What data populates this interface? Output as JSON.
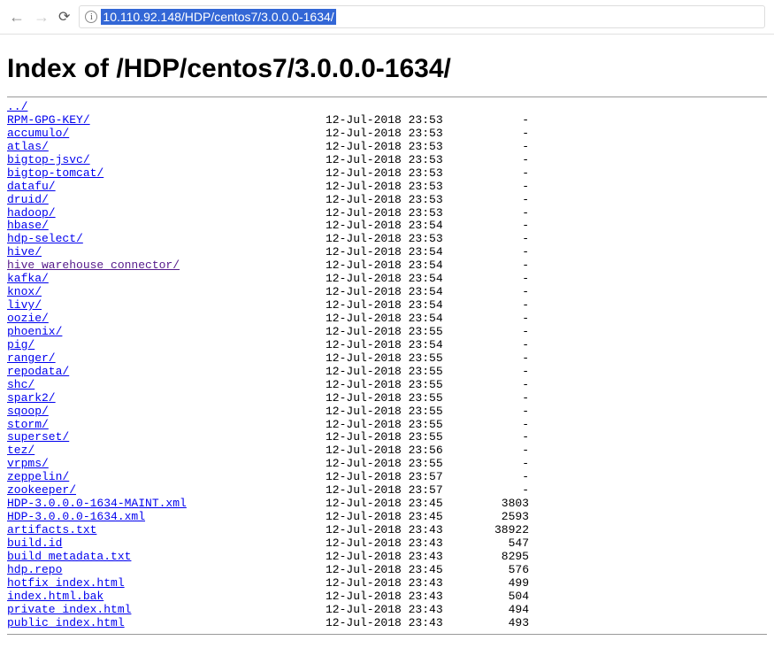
{
  "browser": {
    "url": "10.110.92.148/HDP/centos7/3.0.0.0-1634/"
  },
  "page": {
    "title": "Index of /HDP/centos7/3.0.0.0-1634/",
    "parent_link": "../",
    "entries": [
      {
        "name": "RPM-GPG-KEY/",
        "date": "12-Jul-2018 23:53",
        "size": "-",
        "visited": false
      },
      {
        "name": "accumulo/",
        "date": "12-Jul-2018 23:53",
        "size": "-",
        "visited": false
      },
      {
        "name": "atlas/",
        "date": "12-Jul-2018 23:53",
        "size": "-",
        "visited": false
      },
      {
        "name": "bigtop-jsvc/",
        "date": "12-Jul-2018 23:53",
        "size": "-",
        "visited": false
      },
      {
        "name": "bigtop-tomcat/",
        "date": "12-Jul-2018 23:53",
        "size": "-",
        "visited": false
      },
      {
        "name": "datafu/",
        "date": "12-Jul-2018 23:53",
        "size": "-",
        "visited": false
      },
      {
        "name": "druid/",
        "date": "12-Jul-2018 23:53",
        "size": "-",
        "visited": false
      },
      {
        "name": "hadoop/",
        "date": "12-Jul-2018 23:53",
        "size": "-",
        "visited": false
      },
      {
        "name": "hbase/",
        "date": "12-Jul-2018 23:54",
        "size": "-",
        "visited": false
      },
      {
        "name": "hdp-select/",
        "date": "12-Jul-2018 23:53",
        "size": "-",
        "visited": false
      },
      {
        "name": "hive/",
        "date": "12-Jul-2018 23:54",
        "size": "-",
        "visited": false
      },
      {
        "name": "hive_warehouse_connector/",
        "date": "12-Jul-2018 23:54",
        "size": "-",
        "visited": true
      },
      {
        "name": "kafka/",
        "date": "12-Jul-2018 23:54",
        "size": "-",
        "visited": false
      },
      {
        "name": "knox/",
        "date": "12-Jul-2018 23:54",
        "size": "-",
        "visited": false
      },
      {
        "name": "livy/",
        "date": "12-Jul-2018 23:54",
        "size": "-",
        "visited": false
      },
      {
        "name": "oozie/",
        "date": "12-Jul-2018 23:54",
        "size": "-",
        "visited": false
      },
      {
        "name": "phoenix/",
        "date": "12-Jul-2018 23:55",
        "size": "-",
        "visited": false
      },
      {
        "name": "pig/",
        "date": "12-Jul-2018 23:54",
        "size": "-",
        "visited": false
      },
      {
        "name": "ranger/",
        "date": "12-Jul-2018 23:55",
        "size": "-",
        "visited": false
      },
      {
        "name": "repodata/",
        "date": "12-Jul-2018 23:55",
        "size": "-",
        "visited": false
      },
      {
        "name": "shc/",
        "date": "12-Jul-2018 23:55",
        "size": "-",
        "visited": false
      },
      {
        "name": "spark2/",
        "date": "12-Jul-2018 23:55",
        "size": "-",
        "visited": false
      },
      {
        "name": "sqoop/",
        "date": "12-Jul-2018 23:55",
        "size": "-",
        "visited": false
      },
      {
        "name": "storm/",
        "date": "12-Jul-2018 23:55",
        "size": "-",
        "visited": false
      },
      {
        "name": "superset/",
        "date": "12-Jul-2018 23:55",
        "size": "-",
        "visited": false
      },
      {
        "name": "tez/",
        "date": "12-Jul-2018 23:56",
        "size": "-",
        "visited": false
      },
      {
        "name": "vrpms/",
        "date": "12-Jul-2018 23:55",
        "size": "-",
        "visited": false
      },
      {
        "name": "zeppelin/",
        "date": "12-Jul-2018 23:57",
        "size": "-",
        "visited": false
      },
      {
        "name": "zookeeper/",
        "date": "12-Jul-2018 23:57",
        "size": "-",
        "visited": false
      },
      {
        "name": "HDP-3.0.0.0-1634-MAINT.xml",
        "date": "12-Jul-2018 23:45",
        "size": "3803",
        "visited": false
      },
      {
        "name": "HDP-3.0.0.0-1634.xml",
        "date": "12-Jul-2018 23:45",
        "size": "2593",
        "visited": false
      },
      {
        "name": "artifacts.txt",
        "date": "12-Jul-2018 23:43",
        "size": "38922",
        "visited": false
      },
      {
        "name": "build.id",
        "date": "12-Jul-2018 23:43",
        "size": "547",
        "visited": false
      },
      {
        "name": "build_metadata.txt",
        "date": "12-Jul-2018 23:43",
        "size": "8295",
        "visited": false
      },
      {
        "name": "hdp.repo",
        "date": "12-Jul-2018 23:45",
        "size": "576",
        "visited": false
      },
      {
        "name": "hotfix_index.html",
        "date": "12-Jul-2018 23:43",
        "size": "499",
        "visited": false
      },
      {
        "name": "index.html.bak",
        "date": "12-Jul-2018 23:43",
        "size": "504",
        "visited": false
      },
      {
        "name": "private_index.html",
        "date": "12-Jul-2018 23:43",
        "size": "494",
        "visited": false
      },
      {
        "name": "public_index.html",
        "date": "12-Jul-2018 23:43",
        "size": "493",
        "visited": false
      }
    ]
  }
}
